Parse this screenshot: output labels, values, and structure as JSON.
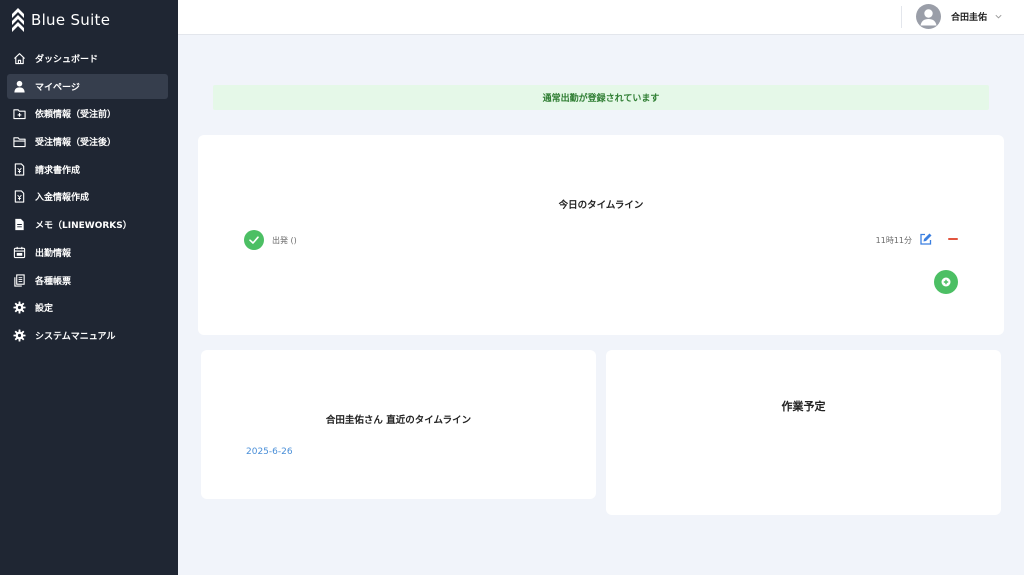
{
  "brand": {
    "name": "Blue Suite"
  },
  "sidebar": {
    "items": [
      {
        "label": "ダッシュボード",
        "icon": "home-icon",
        "active": false
      },
      {
        "label": "マイページ",
        "icon": "user-icon",
        "active": true
      },
      {
        "label": "依頼情報（受注前）",
        "icon": "folder-plus-icon",
        "active": false
      },
      {
        "label": "受注情報（受注後）",
        "icon": "folder-icon",
        "active": false
      },
      {
        "label": "請求書作成",
        "icon": "invoice-icon",
        "active": false
      },
      {
        "label": "入金情報作成",
        "icon": "payment-icon",
        "active": false
      },
      {
        "label": "メモ（LINEWORKS）",
        "icon": "memo-icon",
        "active": false
      },
      {
        "label": "出勤情報",
        "icon": "calendar-icon",
        "active": false
      },
      {
        "label": "各種帳票",
        "icon": "documents-icon",
        "active": false
      },
      {
        "label": "設定",
        "icon": "gear-icon",
        "active": false
      },
      {
        "label": "システムマニュアル",
        "icon": "gear-icon",
        "active": false
      }
    ]
  },
  "header": {
    "user_name": "合田圭佑"
  },
  "alert": {
    "message": "通常出勤が登録されています"
  },
  "today_timeline": {
    "title": "今日のタイムライン",
    "entries": [
      {
        "label": "出発 ()",
        "time": "11時11分"
      }
    ]
  },
  "recent_timeline": {
    "title": "合田圭佑さん 直近のタイムライン",
    "date": "2025-6-26"
  },
  "work_plan": {
    "title": "作業予定"
  },
  "colors": {
    "sidebar_bg": "#1f2633",
    "sidebar_active": "#363e4d",
    "success_green": "#4cbf64",
    "alert_bg": "#e5f8e8",
    "alert_text": "#2e7d32",
    "link_blue": "#4a8fd8",
    "danger_red": "#e2553f",
    "page_bg": "#f1f4fa"
  }
}
